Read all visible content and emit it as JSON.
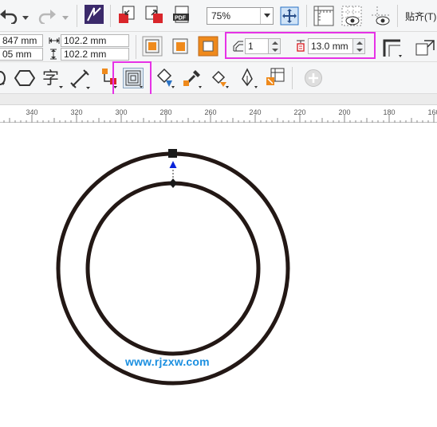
{
  "toolbar_top": {
    "zoom": {
      "value": "75%"
    },
    "snap_label": "贴齐(T)",
    "icons": [
      "undo-icon",
      "redo-icon",
      "corel-connect-icon",
      "import-icon",
      "export-icon",
      "publish-pdf-icon",
      "full-screen-icon",
      "show-rulers-icon",
      "view-icon",
      "guidelines-icon"
    ]
  },
  "property_bar": {
    "x_value": "847 mm",
    "y_value": "05 mm",
    "width_value": "102.2 mm",
    "height_value": "102.2 mm",
    "contour_steps": "1",
    "contour_offset": "13.0 mm"
  },
  "toolbox": {
    "icons": [
      "shape-icon",
      "polygon-icon",
      "text-tool-icon",
      "dimension-tool-icon",
      "connector-tool-icon",
      "contour-tool-icon",
      "fill-tool-icon",
      "eyedropper-icon",
      "interactive-fill-icon",
      "pen-tool-icon",
      "smart-fill-icon",
      "add-tool-icon"
    ]
  },
  "ruler": {
    "ticks": [
      "340",
      "320",
      "300",
      "280",
      "260",
      "240",
      "220",
      "200",
      "180",
      "160"
    ]
  },
  "watermark": {
    "text": "www.rjzxw.com"
  },
  "colors": {
    "highlight": "#e632e6",
    "circle_stroke": "#231815",
    "accent_orange": "#ef8a1c",
    "handle_blue": "#0a24d9"
  }
}
